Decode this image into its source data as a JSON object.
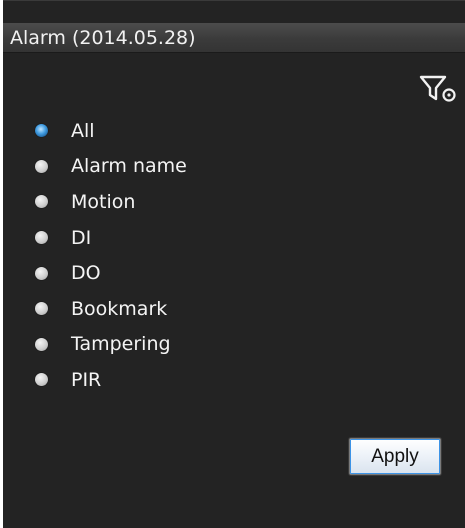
{
  "panel": {
    "title": "Alarm (2014.05.28)"
  },
  "toolbar": {
    "filter_icon": "filter-settings-icon"
  },
  "filter_options": {
    "selected": "All",
    "items": [
      {
        "label": "All",
        "checked": true
      },
      {
        "label": "Alarm name",
        "checked": false
      },
      {
        "label": "Motion",
        "checked": false
      },
      {
        "label": "DI",
        "checked": false
      },
      {
        "label": "DO",
        "checked": false
      },
      {
        "label": "Bookmark",
        "checked": false
      },
      {
        "label": "Tampering",
        "checked": false
      },
      {
        "label": "PIR",
        "checked": false
      }
    ]
  },
  "actions": {
    "apply_label": "Apply"
  },
  "colors": {
    "panel_background": "#232323",
    "title_bar": "#3b3b3b",
    "text": "#f4f4f4",
    "radio_selected": "#3f9be0"
  }
}
